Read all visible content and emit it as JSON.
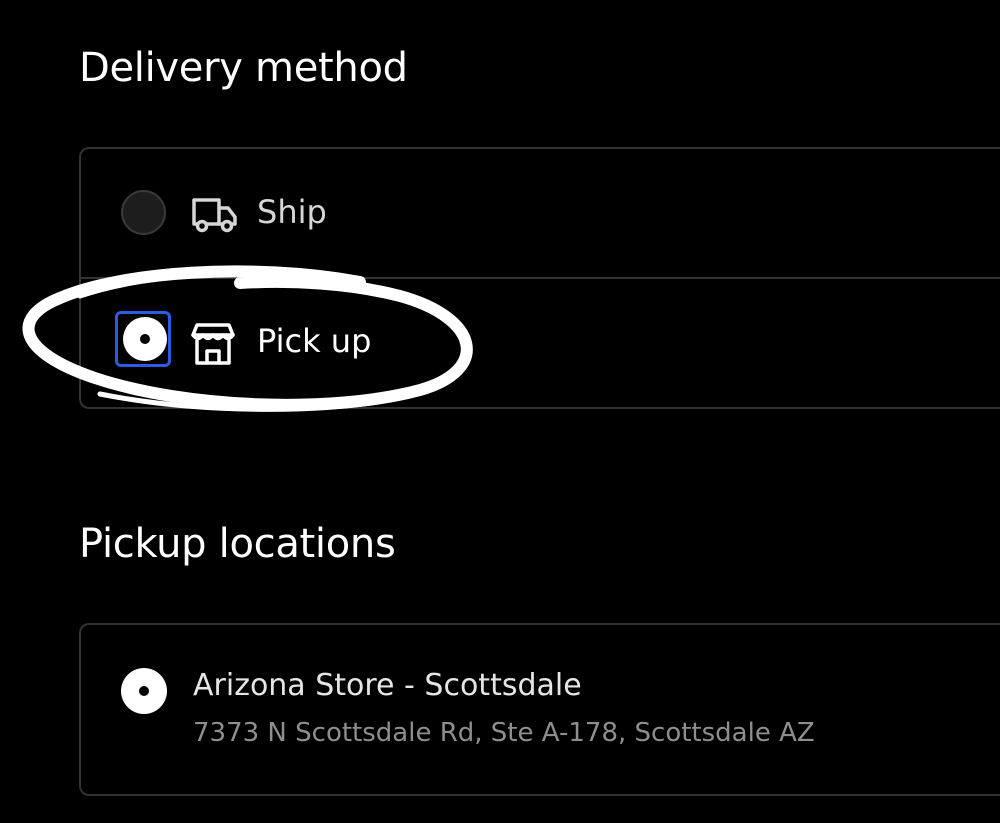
{
  "delivery": {
    "title": "Delivery method",
    "options": [
      {
        "label": "Ship",
        "icon": "truck-icon",
        "selected": false
      },
      {
        "label": "Pick up",
        "icon": "store-icon",
        "selected": true
      }
    ]
  },
  "pickup": {
    "title": "Pickup locations",
    "locations": [
      {
        "name": "Arizona Store - Scottsdale",
        "address": "7373 N Scottsdale Rd, Ste A-178, Scottsdale AZ",
        "selected": true
      }
    ]
  },
  "colors": {
    "background": "#000000",
    "border": "#333333",
    "focus_ring": "#2b5ce6",
    "annotation": "#ffffff"
  }
}
